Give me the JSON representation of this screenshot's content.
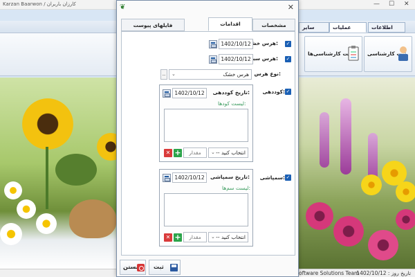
{
  "main_window": {
    "title": "Karzan Baarwon / کارزان باربران",
    "menu_tabs": [
      "اطلاعات پایه",
      "عملیات کارشناسی",
      "سایر عملیات"
    ],
    "ribbon_buttons": [
      "ثبت کارشناسی",
      "لیست کارشناسی‌ها"
    ],
    "status_left": "oftware Solutions Team",
    "status_right": "تاریخ روز : 1402/10/12"
  },
  "dialog": {
    "tabs": [
      "مشخصات",
      "اقدامات",
      "فایلهای پیوست"
    ],
    "active_tab": "اقدامات",
    "dry_pruning": {
      "label": "هرس خشک:",
      "date": "1402/10/12",
      "checked": true
    },
    "green_pruning": {
      "label": "هرس سبز:",
      "date": "1402/10/12",
      "checked": true
    },
    "pruning_type": {
      "label": "نوع هرس:",
      "value": "هرس خشک",
      "extra_button": ".."
    },
    "fertilizing": {
      "label": "کوددهی:",
      "date_label": "تاریخ کوددهی:",
      "date": "1402/10/12",
      "list_label": "لیست کودها:",
      "select_placeholder": "-- انتخاب کنید",
      "quantity_placeholder": "مقدار",
      "checked": true
    },
    "spraying": {
      "label": "سمپاشی:",
      "date_label": "تاریخ سمپاشی:",
      "date": "1402/10/12",
      "list_label": "لیست سم‌ها:",
      "select_placeholder": "-- انتخاب کنید",
      "quantity_placeholder": "مقدار",
      "checked": true
    },
    "footer": {
      "save": "ثبت",
      "close": "بستن"
    }
  },
  "colors": {
    "accent": "#1a5fb4",
    "add": "#2ca44a",
    "delete": "#d93a3a",
    "list_label": "#3a9b5e"
  }
}
